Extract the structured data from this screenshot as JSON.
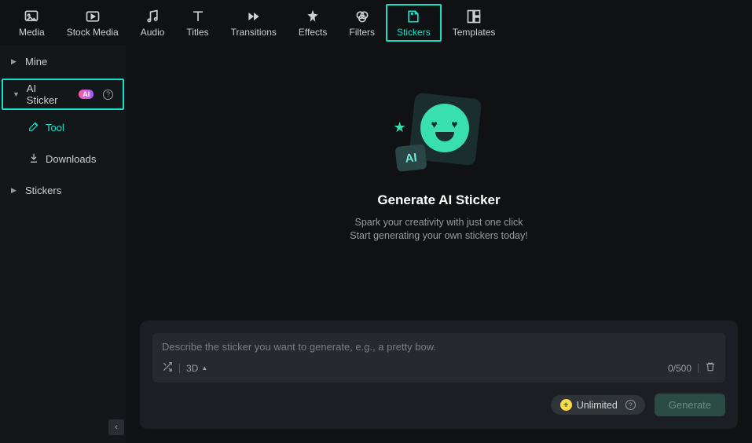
{
  "toolbar": {
    "items": [
      {
        "label": "Media"
      },
      {
        "label": "Stock Media"
      },
      {
        "label": "Audio"
      },
      {
        "label": "Titles"
      },
      {
        "label": "Transitions"
      },
      {
        "label": "Effects"
      },
      {
        "label": "Filters"
      },
      {
        "label": "Stickers"
      },
      {
        "label": "Templates"
      }
    ]
  },
  "sidebar": {
    "mine": "Mine",
    "ai_sticker": "AI Sticker",
    "ai_badge": "AI",
    "tool": "Tool",
    "downloads": "Downloads",
    "stickers": "Stickers"
  },
  "hero": {
    "title": "Generate AI Sticker",
    "line1": "Spark your creativity with just one click",
    "line2": "Start generating your own stickers today!",
    "ai_tag": "AI"
  },
  "prompt": {
    "placeholder": "Describe the sticker you want to generate, e.g., a pretty bow.",
    "style_label": "3D",
    "counter": "0/500",
    "unlimited": "Unlimited",
    "generate": "Generate"
  }
}
